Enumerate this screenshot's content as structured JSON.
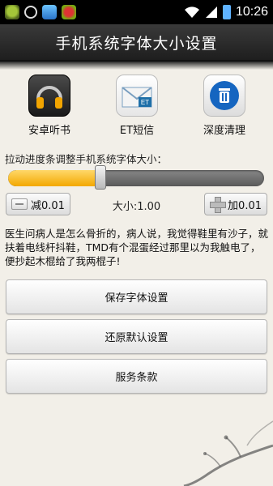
{
  "status_bar": {
    "time": "10:26",
    "notification_icons": [
      "android-app-icon",
      "alarm-clock-icon",
      "photo-app-icon",
      "bird-game-icon"
    ]
  },
  "title": "手机系统字体大小设置",
  "apps": [
    {
      "label": "安卓听书",
      "icon": "headphones-icon",
      "color": "#f2a500"
    },
    {
      "label": "ET短信",
      "icon": "envelope-icon",
      "color": "#1e6fa8"
    },
    {
      "label": "深度清理",
      "icon": "trash-icon",
      "color": "#1565c0"
    }
  ],
  "instruction": "拉动进度条调整手机系统字体大小：",
  "slider": {
    "value_fraction": 0.36
  },
  "controls": {
    "decrease_label": "减0.01",
    "size_label": "大小:1.00",
    "increase_label": "加0.01"
  },
  "joke": "医生问病人是怎么骨折的，病人说，我觉得鞋里有沙子，就扶着电线杆抖鞋，TMD有个混蛋经过那里以为我触电了，便抄起木棍给了我两棍子!",
  "buttons": {
    "save": "保存字体设置",
    "restore": "还原默认设置",
    "terms": "服务条款"
  },
  "colors": {
    "accent": "#f3a800",
    "title_bar": "#2a2a2a"
  }
}
